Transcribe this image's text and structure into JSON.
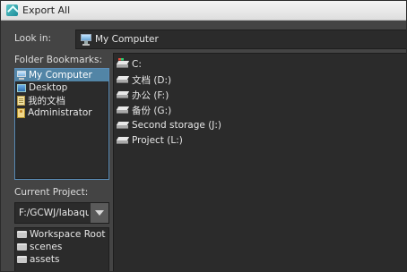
{
  "window": {
    "title": "Export All"
  },
  "look_in": {
    "label": "Look in:",
    "value": "My Computer",
    "icon": "monitor-icon"
  },
  "bookmarks": {
    "label": "Folder Bookmarks:",
    "items": [
      {
        "label": "My Computer",
        "icon": "monitor-icon",
        "selected": true
      },
      {
        "label": "Desktop",
        "icon": "desktop-icon",
        "selected": false
      },
      {
        "label": "我的文档",
        "icon": "document-icon",
        "selected": false
      },
      {
        "label": "Administrator",
        "icon": "user-folder-icon",
        "selected": false
      }
    ]
  },
  "current_project": {
    "label": "Current Project:",
    "value": "F:/GCWJ/labaqu",
    "items": [
      {
        "label": "Workspace Root",
        "icon": "folder-icon"
      },
      {
        "label": "scenes",
        "icon": "folder-icon"
      },
      {
        "label": "assets",
        "icon": "folder-icon"
      }
    ]
  },
  "files": [
    {
      "label": "C:",
      "icon": "drive-icon"
    },
    {
      "label": "文档 (D:)",
      "icon": "drive-icon"
    },
    {
      "label": "办公 (F:)",
      "icon": "drive-icon"
    },
    {
      "label": "备份 (G:)",
      "icon": "drive-icon"
    },
    {
      "label": "Second storage (J:)",
      "icon": "drive-icon"
    },
    {
      "label": "Project (L:)",
      "icon": "drive-icon"
    }
  ],
  "colors": {
    "background": "#444444",
    "panel": "#2b2b2b",
    "selection": "#5285a6",
    "text": "#dcdcdc"
  }
}
